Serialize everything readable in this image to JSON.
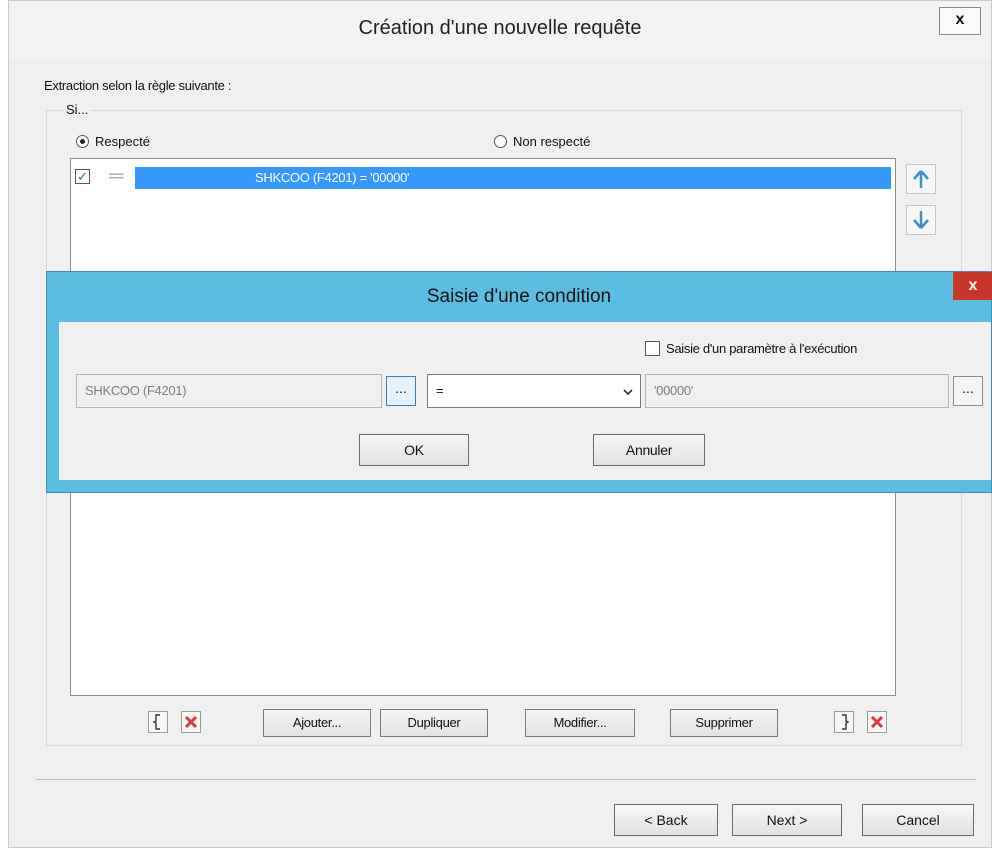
{
  "window": {
    "title": "Création d'une nouvelle requête",
    "close_label": "x"
  },
  "extraction_label": "Extraction selon la règle suivante :",
  "group_label": "Si...",
  "radios": [
    {
      "label": "Respecté",
      "checked": true
    },
    {
      "label": "Non respecté",
      "checked": false
    }
  ],
  "conditions": [
    {
      "checked": true,
      "operator_icon": "equals-icon",
      "text": "SHKCOO (F4201) = '00000'",
      "selected": true
    }
  ],
  "reorder": {
    "up_icon": "arrow-up-icon",
    "down_icon": "arrow-down-icon"
  },
  "toolbar": {
    "open_paren_icon": "open-brace-icon",
    "delete_open_icon": "delete-red-x-icon",
    "add_label": "Ajouter...",
    "duplicate_label": "Dupliquer",
    "modify_label": "Modifier...",
    "delete_label": "Supprimer",
    "close_paren_icon": "close-brace-icon",
    "delete_close_icon": "delete-red-x-icon"
  },
  "wizard": {
    "back_label": "< Back",
    "next_label": "Next >",
    "cancel_label": "Cancel"
  },
  "condition_dialog": {
    "title": "Saisie d'une condition",
    "close_label": "x",
    "param_checkbox_label": "Saisie d'un paramètre à l'exécution",
    "param_checked": false,
    "field_value": "SHKCOO (F4201)",
    "field_browse_label": "...",
    "operator_value": "=",
    "value_value": "'00000'",
    "value_browse_label": "...",
    "ok_label": "OK",
    "cancel_label": "Annuler"
  },
  "colors": {
    "selection": "#3399ff",
    "dialog_frame": "#5bbde2",
    "dialog_close": "#c8362a",
    "check_green": "#1a8a2e"
  }
}
